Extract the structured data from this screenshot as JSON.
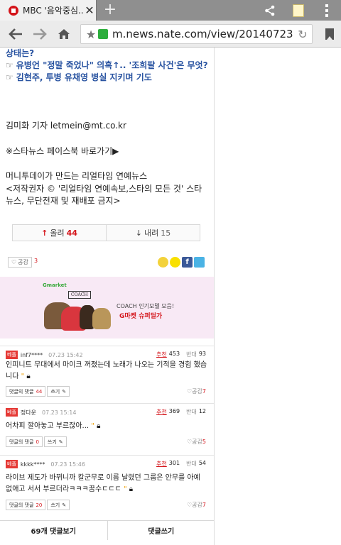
{
  "browser": {
    "tab_title": "MBC '음악중심...",
    "url": "m.news.nate.com/view/20140723n2128",
    "new_tab": "+",
    "close": "✕"
  },
  "article": {
    "related": [
      "상태는?",
      "유병언 \"정말 죽었나\" 의혹↑.. '조희팔 사건'은 무엇?",
      "김현주, 투병 유채영 병실 지키며 기도"
    ],
    "reporter": "김미화 기자 letmein@mt.co.kr",
    "facebook_link": "※스타뉴스 페이스북 바로가기▶",
    "source_line1": "머니투데이가 만드는 리얼타임 연예뉴스",
    "source_line2": "<저작권자 © '리얼타임 연예속보,스타의 모든 것' 스타뉴스, 무단전재 및 재배포 금지>"
  },
  "votes": {
    "up_label": "올려",
    "up_count": "44",
    "down_label": "내려",
    "down_count": "15"
  },
  "share": {
    "gongam_label": "공감",
    "gongam_count": "3"
  },
  "ad": {
    "market_logo": "Gmarket",
    "brand": "COACH",
    "line1": "COACH 인기모델 모음!",
    "line2": "G마켓 슈퍼딜가"
  },
  "comments": [
    {
      "badge": "베플",
      "user": "inf7****",
      "time": "07.23 15:42",
      "rec_label": "추천",
      "rec": "453",
      "opp_label": "반대",
      "opp": "93",
      "text": "인피니트 무대에서 마이크 꺼졌는데 노래가 나오는 기적을 경험 했습니다",
      "reply_label": "댓글의 댓글",
      "reply_count": "44",
      "write_label": "쓰기",
      "gongam_label": "공감",
      "gongam": "7"
    },
    {
      "badge": "베플",
      "user": "정다운",
      "time": "07.23 15:14",
      "rec_label": "추천",
      "rec": "369",
      "opp_label": "반대",
      "opp": "12",
      "text": "어차피 깔아놓고 부르잖아...",
      "reply_label": "댓글의 댓글",
      "reply_count": "0",
      "write_label": "쓰기",
      "gongam_label": "공감",
      "gongam": "5"
    },
    {
      "badge": "베플",
      "user": "kkkk****",
      "time": "07.23 15:46",
      "rec_label": "추천",
      "rec": "301",
      "opp_label": "반대",
      "opp": "54",
      "text": "라이브 제도가 바뀌니까 칼군무로 이름 날렸던 그룹은 안무를 아예 없애고 서서 부르더라ㅋㅋㅋ꿈수ㄷㄷㄷ",
      "reply_label": "댓글의 댓글",
      "reply_count": "20",
      "write_label": "쓰기",
      "gongam_label": "공감",
      "gongam": "7"
    }
  ],
  "bottom": {
    "view_all": "69개 댓글보기",
    "write": "댓글쓰기"
  }
}
